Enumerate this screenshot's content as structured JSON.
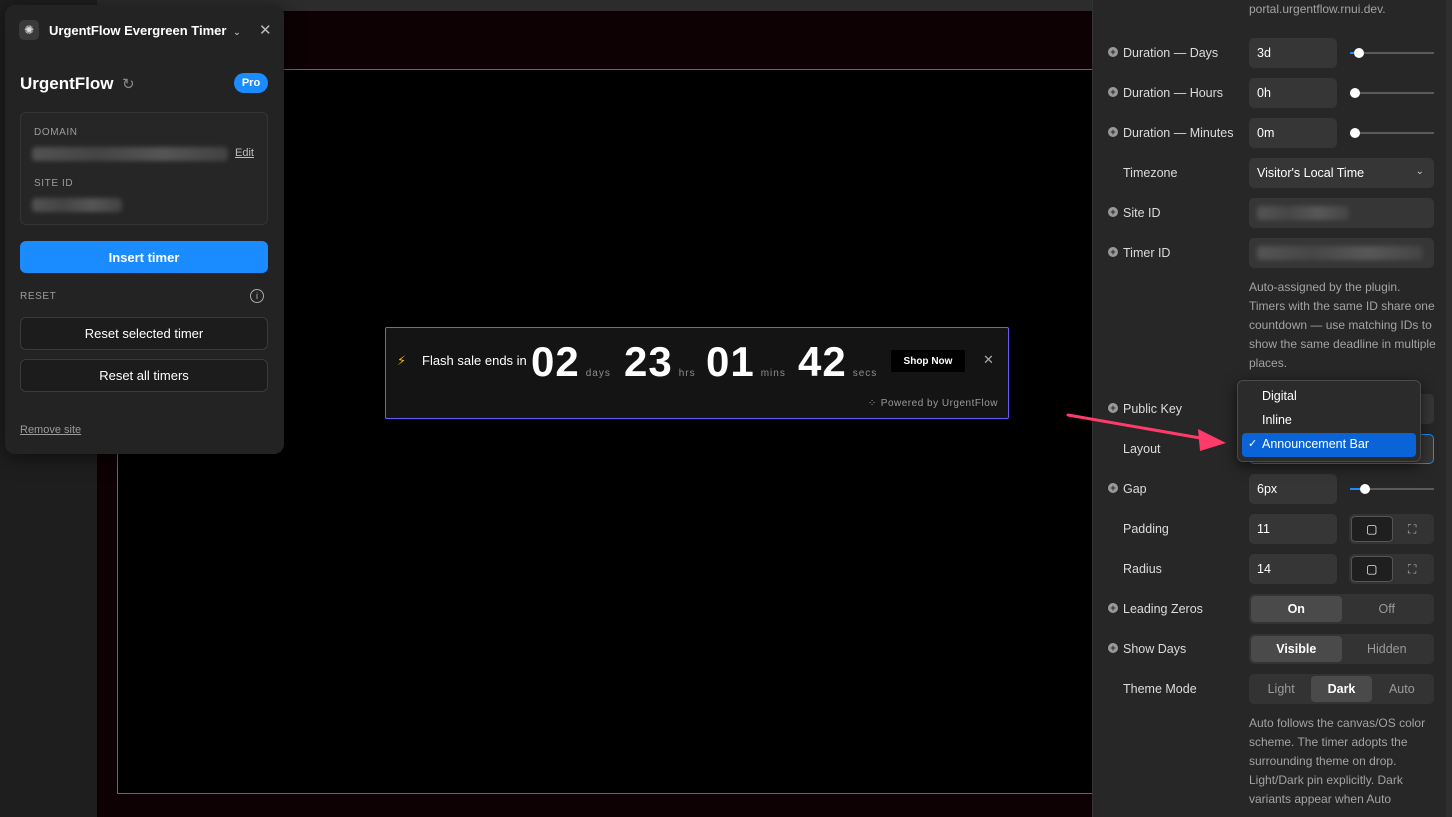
{
  "panel": {
    "title": "UrgentFlow Evergreen Timer",
    "brand": "UrgentFlow",
    "badge": "Pro",
    "domain_label": "DOMAIN",
    "edit_label": "Edit",
    "site_id_label": "SITE ID",
    "insert_label": "Insert timer",
    "reset_label": "RESET",
    "reset_selected": "Reset selected timer",
    "reset_all": "Reset all timers",
    "remove_site": "Remove site"
  },
  "timer": {
    "message": "Flash sale ends in",
    "units": [
      {
        "value": "02",
        "label": "days"
      },
      {
        "value": "23",
        "label": "hrs"
      },
      {
        "value": "01",
        "label": "mins"
      },
      {
        "value": "42",
        "label": "secs"
      }
    ],
    "cta": "Shop Now",
    "powered": "Powered by UrgentFlow"
  },
  "sidebar": {
    "top_help": "portal.urgentflow.rnui.dev.",
    "duration_days_label": "Duration — Days",
    "duration_days_value": "3d",
    "duration_hours_label": "Duration — Hours",
    "duration_hours_value": "0h",
    "duration_minutes_label": "Duration — Minutes",
    "duration_minutes_value": "0m",
    "timezone_label": "Timezone",
    "timezone_value": "Visitor's Local Time",
    "site_id_label": "Site ID",
    "timer_id_label": "Timer ID",
    "timer_id_help": "Auto-assigned by the plugin. Timers with the same ID share one countdown — use matching IDs to show the same deadline in multiple places.",
    "public_key_label": "Public Key",
    "layout_label": "Layout",
    "layout_options": [
      "Digital",
      "Inline",
      "Announcement Bar"
    ],
    "layout_selected": "Announcement Bar",
    "gap_label": "Gap",
    "gap_value": "6px",
    "padding_label": "Padding",
    "padding_value": "11",
    "radius_label": "Radius",
    "radius_value": "14",
    "leading_zeros_label": "Leading Zeros",
    "leading_zeros_options": [
      "On",
      "Off"
    ],
    "show_days_label": "Show Days",
    "show_days_options": [
      "Visible",
      "Hidden"
    ],
    "theme_mode_label": "Theme Mode",
    "theme_mode_options": [
      "Light",
      "Dark",
      "Auto"
    ],
    "theme_help": "Auto follows the canvas/OS color scheme. The timer adopts the surrounding theme on drop. Light/Dark pin explicitly. Dark variants appear when Auto"
  },
  "sliders": {
    "days": 0.05,
    "hours": 0.0,
    "minutes": 0.0,
    "gap": 0.13
  },
  "colors": {
    "accent": "#1a8cff",
    "selection": "#0a64d8",
    "arrow": "#ff3b6b",
    "frame": "#5b5bd6"
  }
}
